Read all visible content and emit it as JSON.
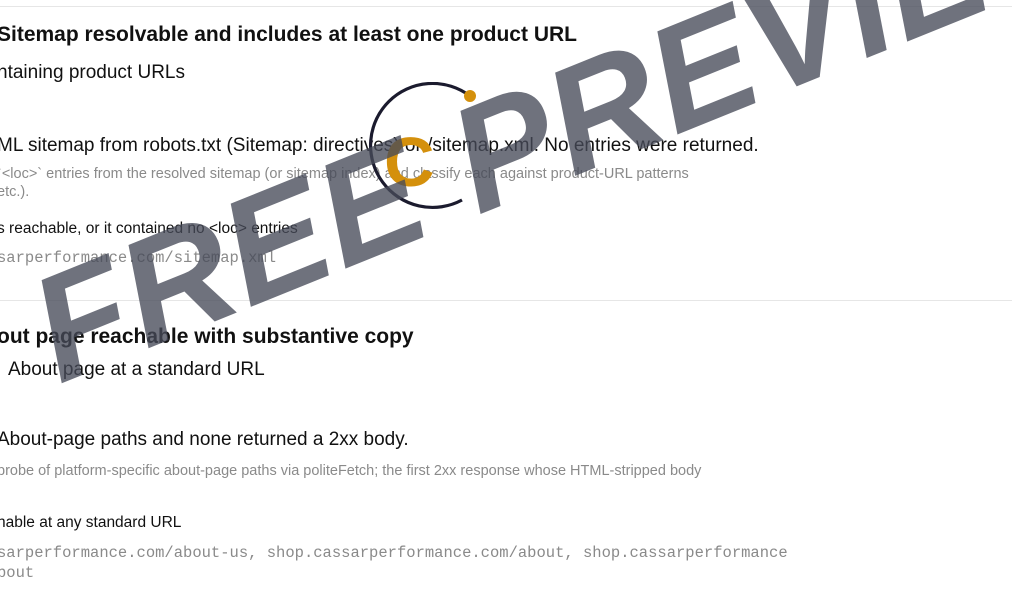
{
  "checks": [
    {
      "title": "Sitemap resolvable and includes at least one product URL",
      "subtitle": "ntaining product URLs",
      "finding": "ML sitemap from robots.txt (Sitemap: directives) or /sitemap.xml. No entries were returned.",
      "method_line1": " `<loc>` entries from the resolved sitemap (or sitemap index) and classify each against product-URL patterns",
      "method_line2": "etc.).",
      "reason": "s reachable, or it contained no <loc> entries",
      "urls": "sarperformance.com/sitemap.xml"
    },
    {
      "title": "out page reachable with substantive copy",
      "subtitle": "About page at a standard URL",
      "finding": "About-page paths and none returned a 2xx body.",
      "method": "probe of platform-specific about-page paths via politeFetch; the first 2xx response whose HTML-stripped body",
      "reason": "hable at any standard URL",
      "urls_line1": "sarperformance.com/about-us, shop.cassarperformance.com/about, shop.cassarperformance",
      "urls_line2": "bout"
    }
  ],
  "watermark": {
    "text": "FREE PREVIEW",
    "color": "#464a58"
  },
  "logo": {
    "letter": "C",
    "accent_color": "#d4900c",
    "ring_color": "#1b1b2e"
  }
}
